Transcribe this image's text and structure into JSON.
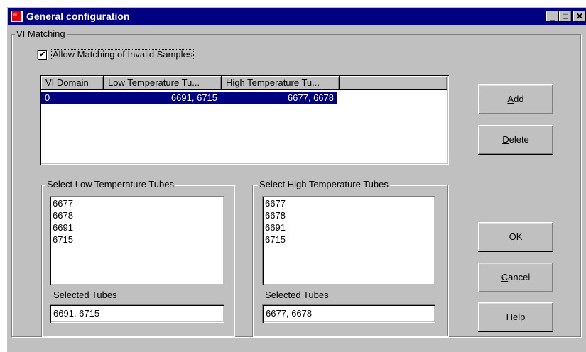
{
  "window": {
    "title": "General configuration",
    "controls": {
      "minimize": "_",
      "maximize": "□",
      "close": "✕"
    }
  },
  "vi_matching": {
    "group_label": "VI Matching",
    "allow_invalid": {
      "label": "Allow Matching of Invalid Samples",
      "checked": true,
      "glyph": "✔"
    }
  },
  "list": {
    "columns": [
      "VI Domain",
      "Low Temperature Tu...",
      "High Temperature Tu..."
    ],
    "rows": [
      {
        "domain": "0",
        "low": "6691, 6715",
        "high": "6677, 6678",
        "selected": true
      }
    ]
  },
  "buttons": {
    "add": {
      "pre": "",
      "ul": "A",
      "post": "dd"
    },
    "delete": {
      "pre": "",
      "ul": "D",
      "post": "elete"
    },
    "ok": {
      "pre": "O",
      "ul": "K",
      "post": ""
    },
    "cancel": {
      "pre": "",
      "ul": "C",
      "post": "ancel"
    },
    "help": {
      "pre": "",
      "ul": "H",
      "post": "elp"
    }
  },
  "low_group": {
    "label": "Select Low Temperature Tubes",
    "items": [
      "6677",
      "6678",
      "6691",
      "6715"
    ],
    "selected_label": "Selected Tubes",
    "selected_value": "6691, 6715"
  },
  "high_group": {
    "label": "Select High Temperature Tubes",
    "items": [
      "6677",
      "6678",
      "6691",
      "6715"
    ],
    "selected_label": "Selected Tubes",
    "selected_value": "6677, 6678"
  },
  "colors": {
    "titlebar": "#000080",
    "selection": "#000080",
    "face": "#c0c0c0",
    "app_icon": "#e8000c"
  },
  "icons": {
    "app": "red-app-icon"
  }
}
